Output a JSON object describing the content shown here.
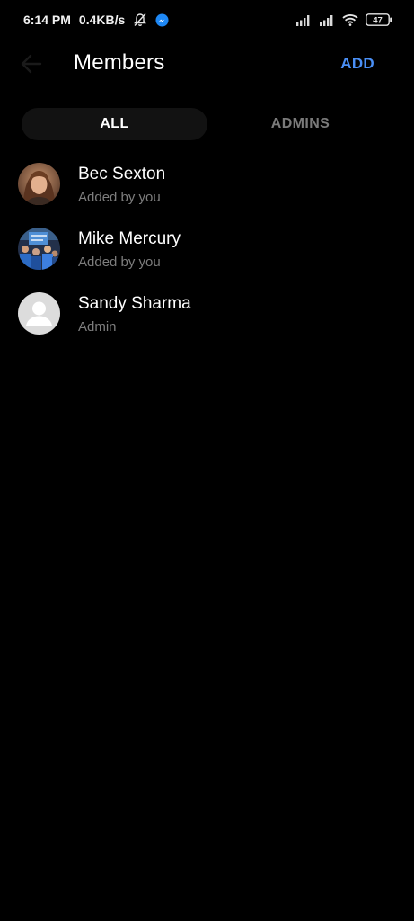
{
  "status_bar": {
    "time": "6:14 PM",
    "speed": "0.4KB/s",
    "battery": "47",
    "icons": [
      "mute-bell-icon",
      "messenger-icon",
      "signal-icon",
      "signal-icon",
      "wifi-icon",
      "battery-icon"
    ]
  },
  "header": {
    "title": "Members",
    "add_label": "ADD",
    "back_icon": "back-arrow-icon"
  },
  "tabs": [
    {
      "label": "ALL",
      "active": true
    },
    {
      "label": "ADMINS",
      "active": false
    }
  ],
  "members": [
    {
      "name": "Bec Sexton",
      "subtitle": "Added by you",
      "avatar": "photo"
    },
    {
      "name": "Mike Mercury",
      "subtitle": "Added by you",
      "avatar": "photo"
    },
    {
      "name": "Sandy Sharma",
      "subtitle": "Admin",
      "avatar": "default-person-icon"
    }
  ],
  "colors": {
    "background": "#000000",
    "accent": "#4a8ff5",
    "subtitle": "#7d7d7d",
    "tab_active_bg": "#121212"
  }
}
